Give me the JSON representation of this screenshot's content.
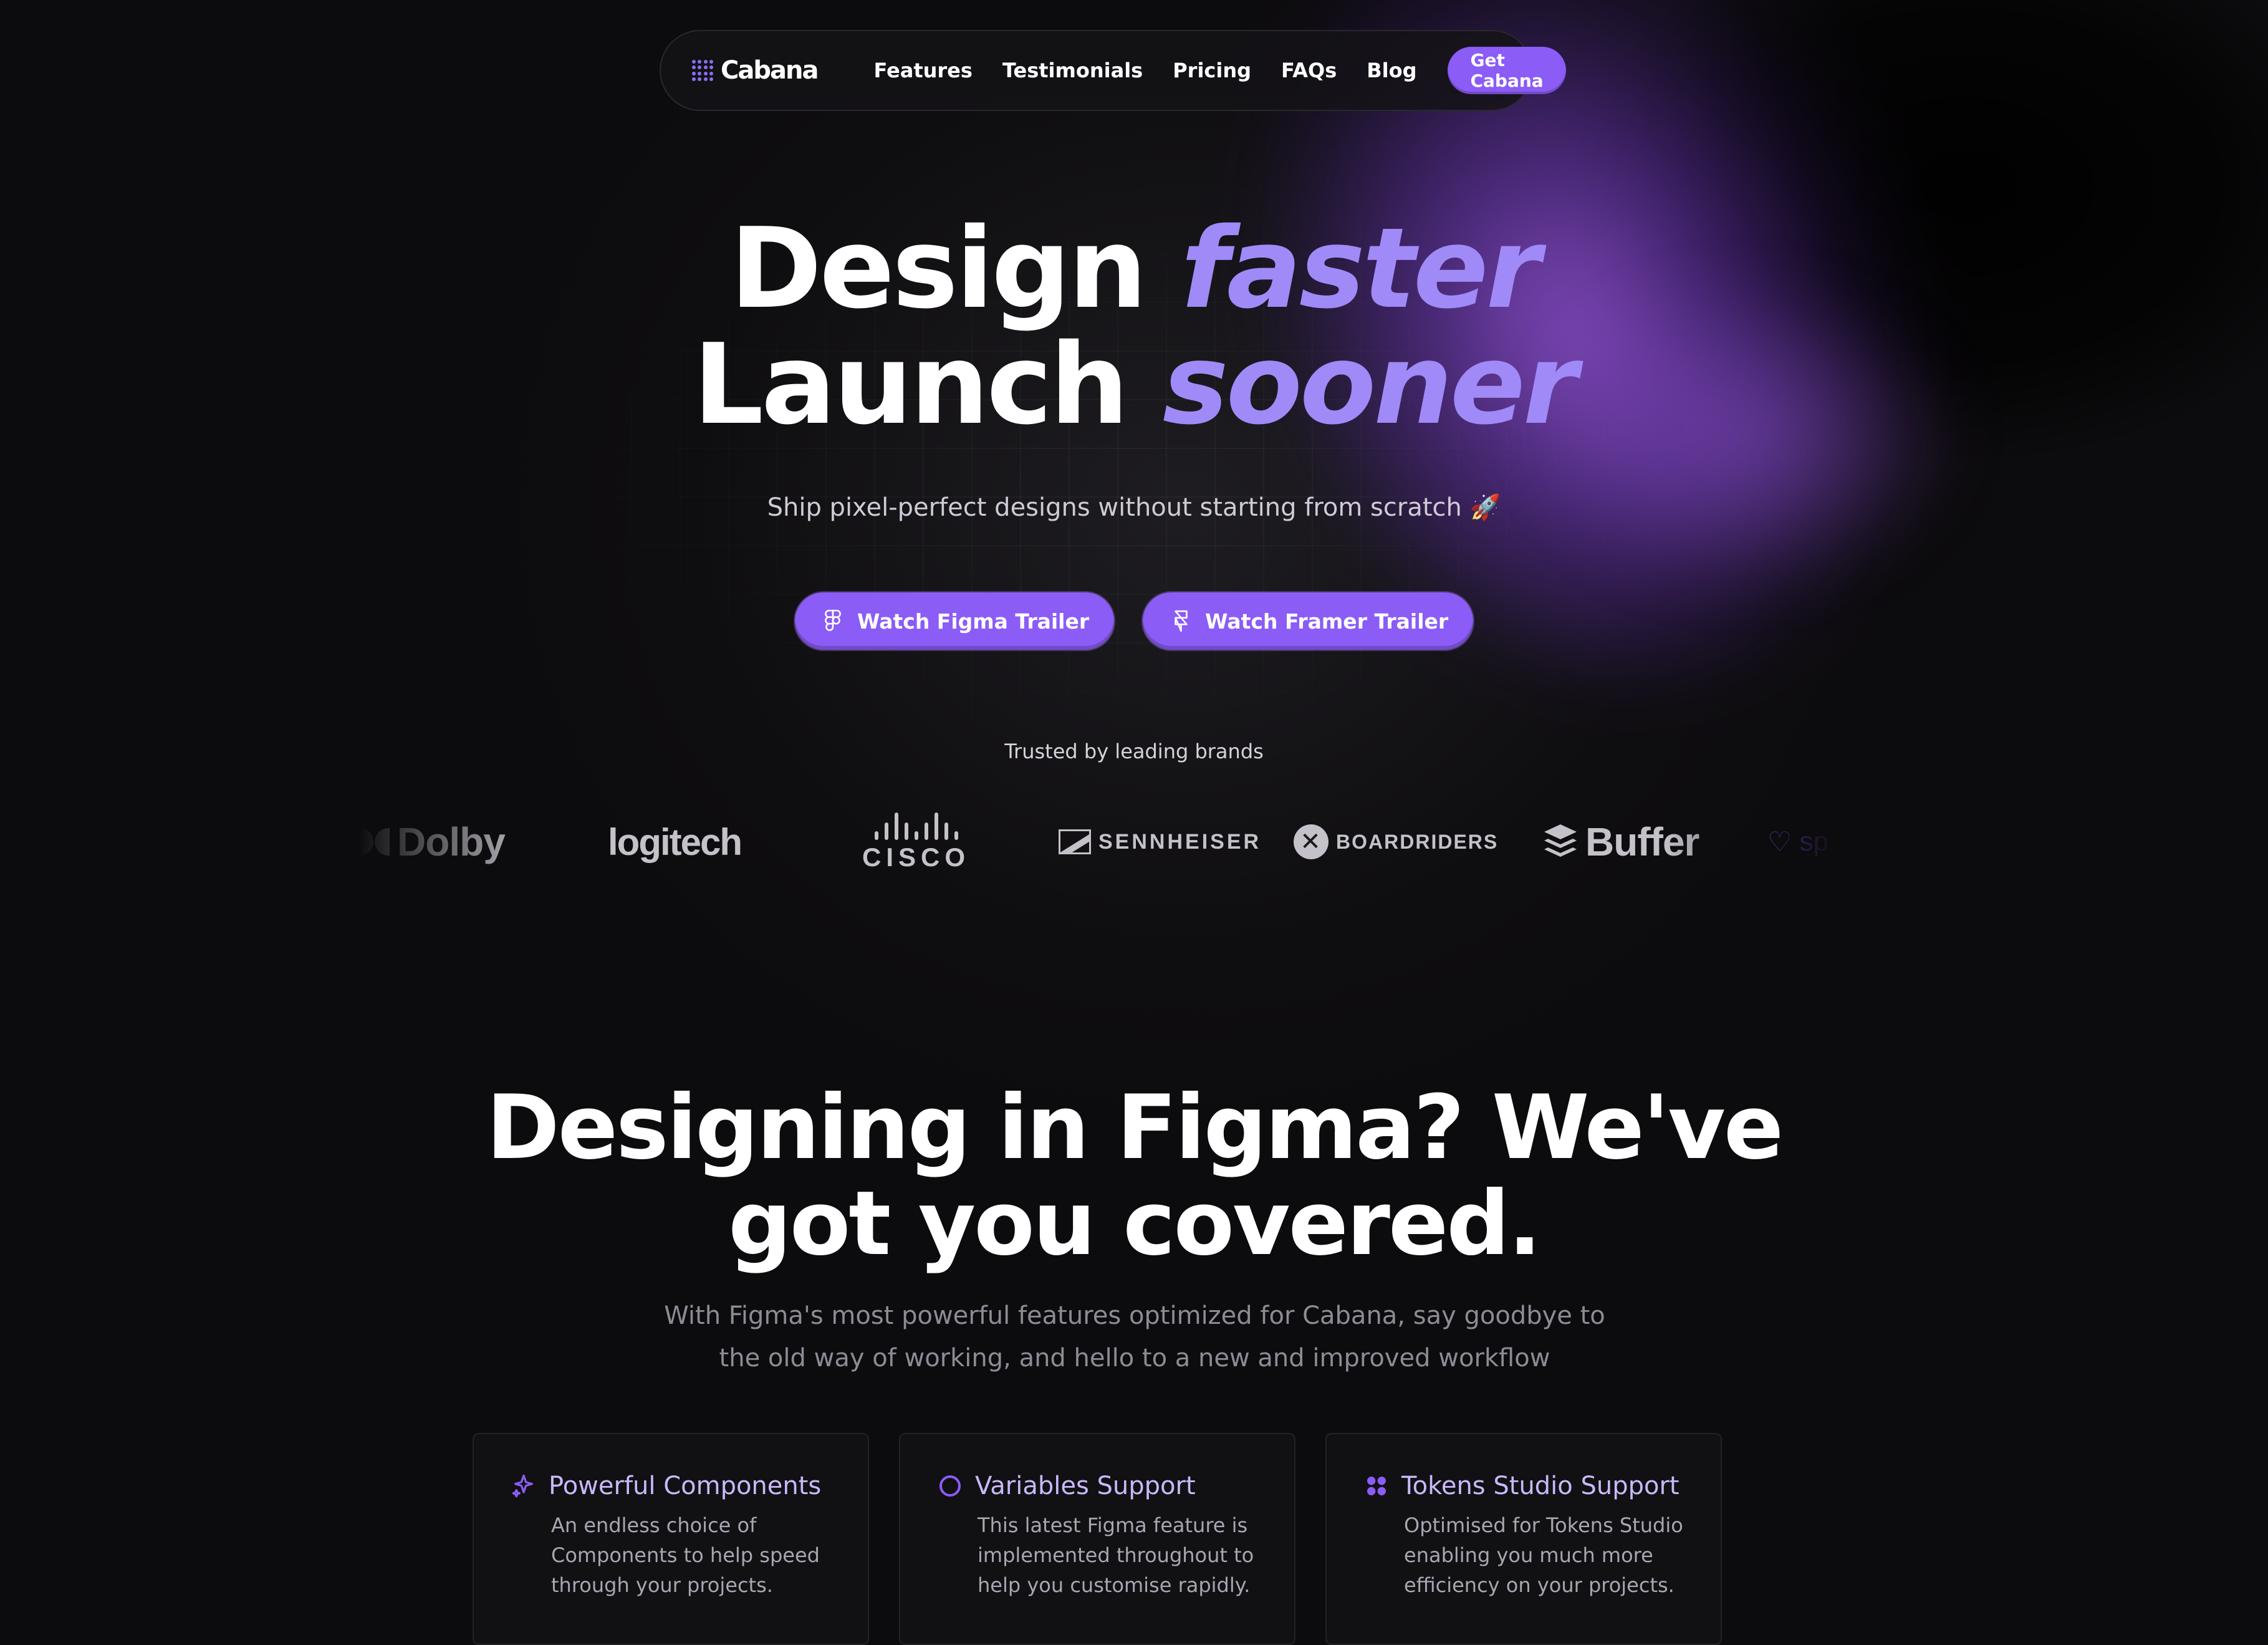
{
  "nav": {
    "logo": "Cabana",
    "links": [
      "Features",
      "Testimonials",
      "Pricing",
      "FAQs",
      "Blog"
    ],
    "cta": "Get Cabana"
  },
  "hero": {
    "line1_plain": "Design",
    "line1_accent": "faster",
    "line2_plain": "Launch",
    "line2_accent": "sooner",
    "subtitle": "Ship pixel-perfect designs without starting from scratch 🚀",
    "buttons": [
      {
        "label": "Watch Figma Trailer",
        "icon": "figma-icon"
      },
      {
        "label": "Watch Framer Trailer",
        "icon": "framer-icon"
      }
    ]
  },
  "trusted": {
    "label": "Trusted by leading brands",
    "brands": [
      "Dolby",
      "logitech",
      "CISCO",
      "SENNHEISER",
      "BOARDRIDERS",
      "Buffer",
      "sp"
    ]
  },
  "section": {
    "title_line1": "Designing in Figma? We've",
    "title_line2": "got you covered.",
    "subtitle_line1": "With Figma's most powerful features optimized for Cabana, say goodbye to",
    "subtitle_line2": "the old way of working, and hello to a new and improved workflow"
  },
  "cards": [
    {
      "title": "Powerful Components",
      "icon": "sparkle-icon",
      "lines": [
        "An endless choice of",
        "Components to help speed",
        "through your projects."
      ]
    },
    {
      "title": "Variables Support",
      "icon": "circle-icon",
      "lines": [
        "This latest Figma feature is",
        "implemented throughout to",
        "help you customise rapidly."
      ]
    },
    {
      "title": "Tokens Studio Support",
      "icon": "tokens-icon",
      "lines": [
        "Optimised for Tokens Studio",
        "enabling you much more",
        "efficiency on your projects."
      ]
    }
  ],
  "colors": {
    "accent": "#8b5cf6",
    "accent_text": "#a08af7",
    "background": "#0c0b0d"
  }
}
